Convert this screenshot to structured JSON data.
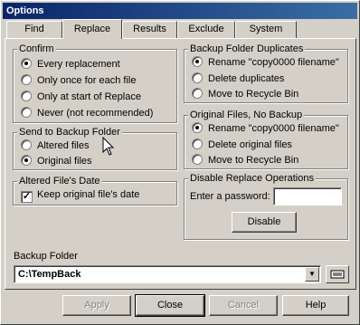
{
  "window": {
    "title": "Options"
  },
  "tabs": [
    {
      "label": "Find"
    },
    {
      "label": "Replace"
    },
    {
      "label": "Results"
    },
    {
      "label": "Exclude"
    },
    {
      "label": "System"
    }
  ],
  "active_tab": "Replace",
  "confirm": {
    "title": "Confirm",
    "options": [
      {
        "label": "Every replacement",
        "selected": true
      },
      {
        "label": "Only once for each file",
        "selected": false
      },
      {
        "label": "Only at start of Replace",
        "selected": false
      },
      {
        "label": "Never (not recommended)",
        "selected": false
      }
    ]
  },
  "send_to_backup": {
    "title": "Send to Backup Folder",
    "options": [
      {
        "label": "Altered files",
        "selected": false
      },
      {
        "label": "Original files",
        "selected": true
      }
    ]
  },
  "altered_date": {
    "title": "Altered File's Date",
    "checkbox_label": "Keep original file's date",
    "checked": true
  },
  "backup_duplicates": {
    "title": "Backup Folder Duplicates",
    "options": [
      {
        "label": "Rename \"copy0000 filename\"",
        "selected": true
      },
      {
        "label": "Delete duplicates",
        "selected": false
      },
      {
        "label": "Move to Recycle Bin",
        "selected": false
      }
    ]
  },
  "original_no_backup": {
    "title": "Original Files, No Backup",
    "options": [
      {
        "label": "Rename \"copy0000 filename\"",
        "selected": true
      },
      {
        "label": "Delete original files",
        "selected": false
      },
      {
        "label": "Move to Recycle Bin",
        "selected": false
      }
    ]
  },
  "disable_replace": {
    "title": "Disable Replace Operations",
    "password_label": "Enter a password:",
    "password_value": "",
    "disable_button": "Disable"
  },
  "backup_folder": {
    "label": "Backup Folder",
    "value": "C:\\TempBack"
  },
  "buttons": {
    "apply": "Apply",
    "close": "Close",
    "cancel": "Cancel",
    "help": "Help"
  }
}
